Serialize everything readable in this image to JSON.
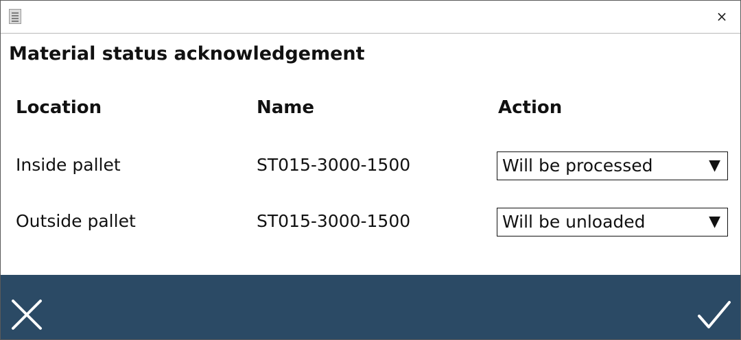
{
  "window": {
    "icon": "document-icon",
    "close_glyph": "×"
  },
  "dialog": {
    "title": "Material status acknowledgement"
  },
  "table": {
    "headers": [
      "Location",
      "Name",
      "Action"
    ],
    "rows": [
      {
        "location": "Inside pallet",
        "name": "ST015-3000-1500",
        "action": "Will be processed"
      },
      {
        "location": "Outside pallet",
        "name": "ST015-3000-1500",
        "action": "Will be unloaded"
      }
    ],
    "dropdown_arrow": "▼"
  },
  "footer": {
    "background": "#2b4a65",
    "cancel_icon": "close-x-icon",
    "confirm_icon": "checkmark-icon"
  }
}
